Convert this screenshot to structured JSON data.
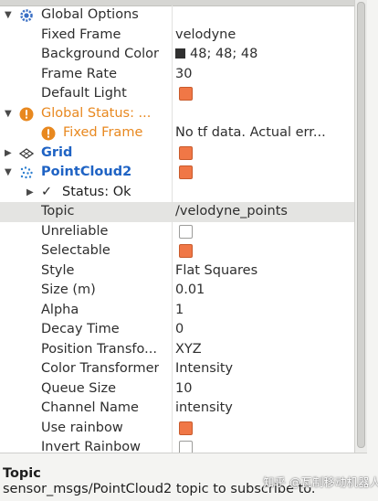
{
  "tree": {
    "global_options": {
      "label": "Global Options",
      "props": [
        {
          "name": "Fixed Frame",
          "value": "velodyne"
        },
        {
          "name": "Background Color",
          "value": "48; 48; 48",
          "color": "#303030"
        },
        {
          "name": "Frame Rate",
          "value": "30"
        },
        {
          "name": "Default Light",
          "checked": true
        }
      ]
    },
    "global_status": {
      "label": "Global Status: ...",
      "fixed_frame": {
        "name": "Fixed Frame",
        "value": "No tf data.  Actual err..."
      }
    },
    "grid": {
      "label": "Grid",
      "checked": true
    },
    "pointcloud2": {
      "label": "PointCloud2",
      "checked": true,
      "status": "Status: Ok",
      "props": [
        {
          "name": "Topic",
          "value": "/velodyne_points"
        },
        {
          "name": "Unreliable",
          "checked": false
        },
        {
          "name": "Selectable",
          "checked": true
        },
        {
          "name": "Style",
          "value": "Flat Squares"
        },
        {
          "name": "Size (m)",
          "value": "0.01"
        },
        {
          "name": "Alpha",
          "value": "1"
        },
        {
          "name": "Decay Time",
          "value": "0"
        },
        {
          "name": "Position Transfo...",
          "value": "XYZ"
        },
        {
          "name": "Color Transformer",
          "value": "Intensity"
        },
        {
          "name": "Queue Size",
          "value": "10"
        },
        {
          "name": "Channel Name",
          "value": "intensity"
        },
        {
          "name": "Use rainbow",
          "checked": true
        },
        {
          "name": "Invert Rainbow",
          "checked": false
        }
      ]
    }
  },
  "help": {
    "title": "Topic",
    "description": "sensor_msgs/PointCloud2 topic to subscribe to."
  },
  "watermark": "知乎 @瓦制移动机器人",
  "colors": {
    "checkbox_on": "#f07746",
    "link_blue": "#1f63c4",
    "warning_orange": "#e8881f",
    "selection": "#e4e4e2"
  }
}
